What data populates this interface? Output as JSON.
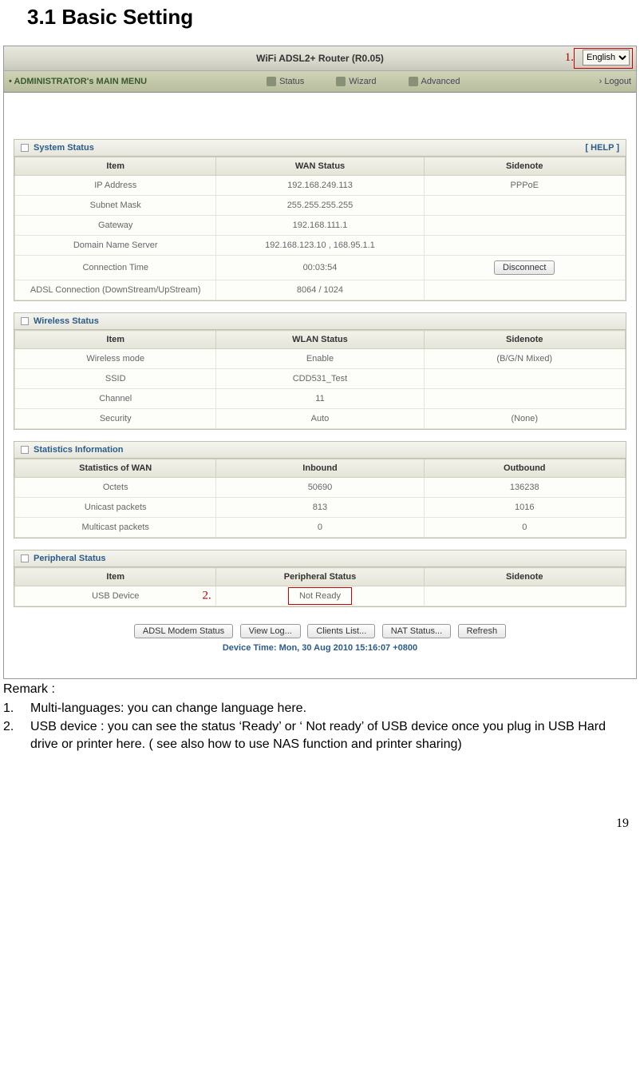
{
  "doc": {
    "heading": "3.1  Basic Setting",
    "remark_label": "Remark :",
    "remark1_num": "1.",
    "remark1_text": "Multi-languages: you can change language here.",
    "remark2_num": "2.",
    "remark2_text": "USB device : you can see the status ‘Ready’ or ‘ Not ready’ of USB device once you plug in USB Hard drive or printer here. ( see also how to use NAS function and printer sharing)",
    "page_number": "19",
    "callout1": "1.",
    "callout2": "2."
  },
  "topbar": {
    "title": "WiFi ADSL2+ Router   (R0.05)",
    "language": "English"
  },
  "menu": {
    "main": "ADMINISTRATOR's MAIN MENU",
    "status": "Status",
    "wizard": "Wizard",
    "advanced": "Advanced",
    "logout": "Logout"
  },
  "system": {
    "title": "System Status",
    "help": "[ HELP ]",
    "h_item": "Item",
    "h_wan": "WAN Status",
    "h_side": "Sidenote",
    "rows": [
      {
        "item": "IP Address",
        "val": "192.168.249.113",
        "note": "PPPoE"
      },
      {
        "item": "Subnet Mask",
        "val": "255.255.255.255",
        "note": ""
      },
      {
        "item": "Gateway",
        "val": "192.168.111.1",
        "note": ""
      },
      {
        "item": "Domain Name Server",
        "val": "192.168.123.10 , 168.95.1.1",
        "note": ""
      },
      {
        "item": "Connection Time",
        "val": "00:03:54",
        "note": ""
      },
      {
        "item": "ADSL Connection (DownStream/UpStream)",
        "val": "8064 / 1024",
        "note": ""
      }
    ],
    "disconnect": "Disconnect"
  },
  "wireless": {
    "title": "Wireless Status",
    "h_item": "Item",
    "h_wlan": "WLAN Status",
    "h_side": "Sidenote",
    "rows": [
      {
        "item": "Wireless mode",
        "val": "Enable",
        "note": "(B/G/N Mixed)"
      },
      {
        "item": "SSID",
        "val": "CDD531_Test",
        "note": ""
      },
      {
        "item": "Channel",
        "val": "11",
        "note": ""
      },
      {
        "item": "Security",
        "val": "Auto",
        "note": "(None)"
      }
    ]
  },
  "stats": {
    "title": "Statistics Information",
    "h_wan": "Statistics of WAN",
    "h_in": "Inbound",
    "h_out": "Outbound",
    "rows": [
      {
        "item": "Octets",
        "in": "50690",
        "out": "136238"
      },
      {
        "item": "Unicast packets",
        "in": "813",
        "out": "1016"
      },
      {
        "item": "Multicast packets",
        "in": "0",
        "out": "0"
      }
    ]
  },
  "periph": {
    "title": "Peripheral Status",
    "h_item": "Item",
    "h_stat": "Peripheral Status",
    "h_side": "Sidenote",
    "row_item": "USB Device",
    "row_val": "Not Ready",
    "row_note": ""
  },
  "buttons": {
    "adsl": "ADSL Modem Status",
    "viewlog": "View Log...",
    "clients": "Clients List...",
    "nat": "NAT Status...",
    "refresh": "Refresh"
  },
  "device_time": "Device Time: Mon, 30 Aug 2010 15:16:07 +0800"
}
